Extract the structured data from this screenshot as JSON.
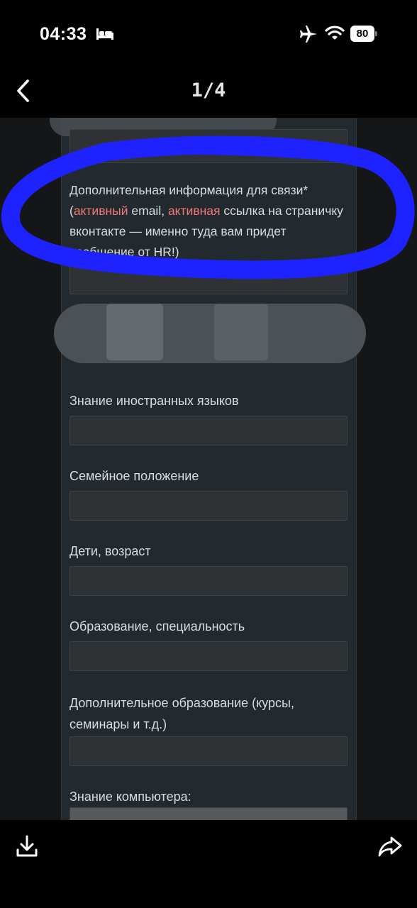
{
  "status_bar": {
    "time": "04:33",
    "battery": "80",
    "icons": [
      "bed-icon",
      "airplane-icon",
      "wifi-icon",
      "battery-icon"
    ]
  },
  "nav": {
    "counter": "1/4",
    "back_icon": "chevron-left-icon"
  },
  "form": {
    "contact_label": {
      "part1": "Дополнительная информация для связи*",
      "part2": "(",
      "accent1": "активный",
      "part3": " email, ",
      "accent2": "активная",
      "part4": " ссылка на страничку вконтакте — именно туда вам придет сообщение от HR!)"
    },
    "fields": [
      {
        "label": "Знание иностранных языков"
      },
      {
        "label": "Семейное положение"
      },
      {
        "label": "Дети, возраст"
      },
      {
        "label": "Образование, специальность"
      },
      {
        "label": "Дополнительное образование (курсы, семинары и т.д.)"
      },
      {
        "label": "Знание компьютера:"
      }
    ],
    "accent_color": "#f07878",
    "highlight_color": "#1e22ff"
  },
  "toolbar": {
    "icons": [
      "download-icon",
      "share-icon"
    ]
  }
}
